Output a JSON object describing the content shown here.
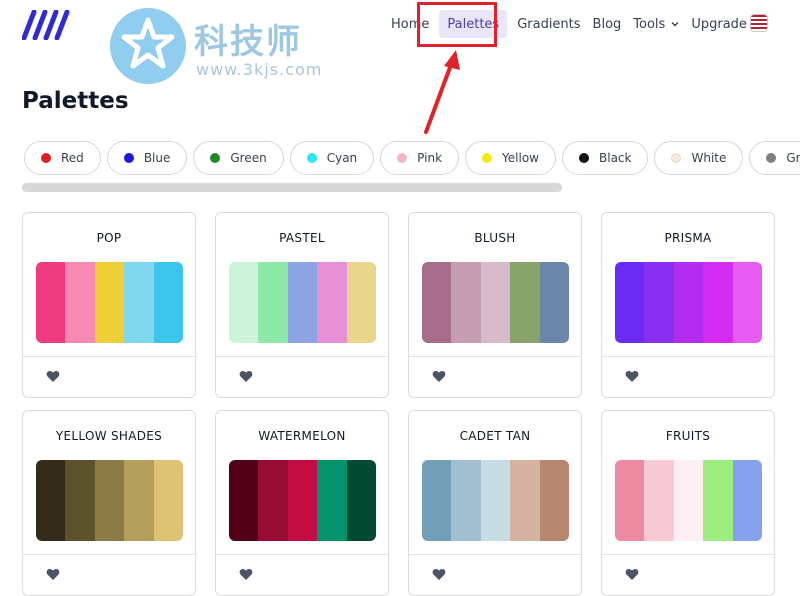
{
  "watermark": {
    "title": "科技师",
    "url": "www.3kjs.com"
  },
  "nav": {
    "items": [
      {
        "label": "Home"
      },
      {
        "label": "Palettes"
      },
      {
        "label": "Gradients"
      },
      {
        "label": "Blog"
      },
      {
        "label": "Tools"
      },
      {
        "label": "Upgrade"
      }
    ],
    "active": "Palettes"
  },
  "page_title": "Palettes",
  "filters": [
    {
      "label": "Red",
      "color": "#e01e1e"
    },
    {
      "label": "Blue",
      "color": "#1a1ad6"
    },
    {
      "label": "Green",
      "color": "#1f8a2a"
    },
    {
      "label": "Cyan",
      "color": "#2de6f0"
    },
    {
      "label": "Pink",
      "color": "#f6b6c6"
    },
    {
      "label": "Yellow",
      "color": "#f2ec10"
    },
    {
      "label": "Black",
      "color": "#111111"
    },
    {
      "label": "White",
      "color": "#f4e9dc"
    },
    {
      "label": "Grey",
      "color": "#808080"
    }
  ],
  "palettes": [
    {
      "name": "POP",
      "colors": [
        "#ee3a7e",
        "#f68ab3",
        "#eecf38",
        "#80d8ee",
        "#3cc6ec"
      ]
    },
    {
      "name": "PASTEL",
      "colors": [
        "#ccf4da",
        "#8ee8a6",
        "#8ca4e4",
        "#e890d6",
        "#ead58c"
      ]
    },
    {
      "name": "BLUSH",
      "colors": [
        "#a66c8a",
        "#c69eb2",
        "#d6bcca",
        "#86a46c",
        "#6a86a8"
      ]
    },
    {
      "name": "PRISMA",
      "colors": [
        "#6a2cf2",
        "#8a2ef2",
        "#b22cf2",
        "#d42cf2",
        "#e85cf4"
      ]
    },
    {
      "name": "YELLOW SHADES",
      "colors": [
        "#342c1a",
        "#5c532c",
        "#8a7c44",
        "#b4a05c",
        "#dcc474"
      ]
    },
    {
      "name": "WATERMELON",
      "colors": [
        "#520018",
        "#960c32",
        "#c40c44",
        "#04926a",
        "#044a32"
      ]
    },
    {
      "name": "CADET TAN",
      "colors": [
        "#729eb8",
        "#a2c0d2",
        "#c8dce4",
        "#d6b2a2",
        "#b68670"
      ]
    },
    {
      "name": "FRUITS",
      "colors": [
        "#ee8aa2",
        "#f8cad6",
        "#fcf0f4",
        "#9cee7e",
        "#86a2ee"
      ]
    }
  ],
  "colors": {
    "accent": "#4b3fb3",
    "highlight": "#e0222a",
    "heart": "#4b5563"
  }
}
